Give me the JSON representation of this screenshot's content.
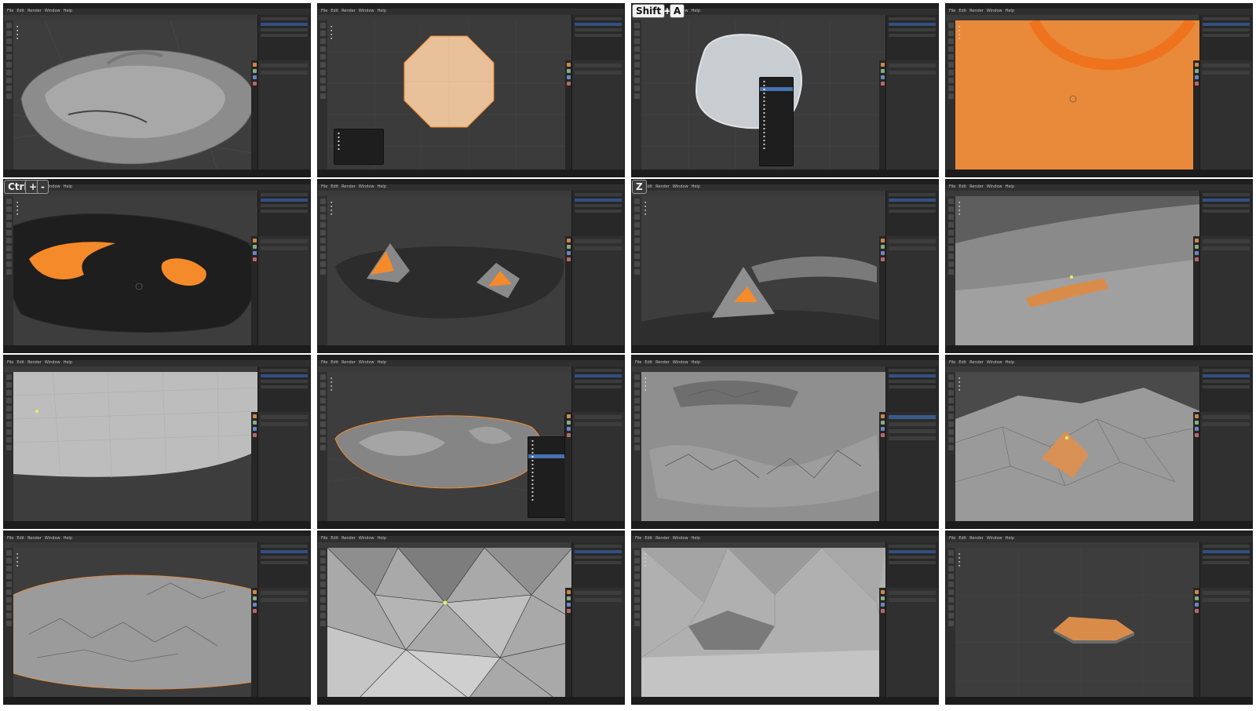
{
  "menu_labels": [
    "File",
    "Edit",
    "Render",
    "Window",
    "Help"
  ],
  "keys": {
    "shift": "Shift",
    "a": "A",
    "ctrl": "Ctrl",
    "plus": "+",
    "minus": "-",
    "z": "Z"
  },
  "colors": {
    "selection_orange": "#f58a2a",
    "viewport_bg": "#3d3d3d",
    "mesh_gray": "#9a9a9a"
  },
  "tiles": [
    {
      "id": 1,
      "scene": "terrain-island"
    },
    {
      "id": 2,
      "scene": "octagon-plane"
    },
    {
      "id": 3,
      "scene": "blob-add-menu"
    },
    {
      "id": 4,
      "scene": "orange-closeup"
    },
    {
      "id": 5,
      "scene": "dark-mesh-selection"
    },
    {
      "id": 6,
      "scene": "extruded-ridges"
    },
    {
      "id": 7,
      "scene": "single-peak"
    },
    {
      "id": 8,
      "scene": "ridge-closeup"
    },
    {
      "id": 9,
      "scene": "flat-mesh-closeup"
    },
    {
      "id": 10,
      "scene": "island-modifier-menu"
    },
    {
      "id": 11,
      "scene": "rock-field"
    },
    {
      "id": 12,
      "scene": "lowpoly-peak"
    },
    {
      "id": 13,
      "scene": "rocky-island"
    },
    {
      "id": 14,
      "scene": "lowpoly-facets"
    },
    {
      "id": 15,
      "scene": "lowpoly-smooth"
    },
    {
      "id": 16,
      "scene": "small-block"
    }
  ]
}
